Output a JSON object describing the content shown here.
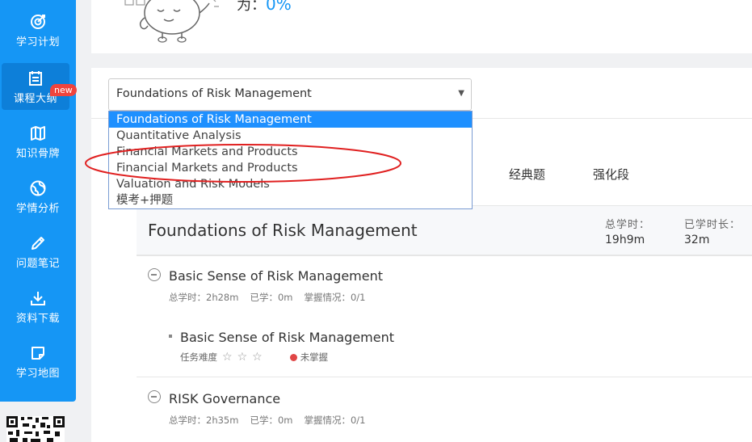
{
  "sidebar": {
    "items": [
      {
        "label": "学习计划",
        "icon": "target-icon"
      },
      {
        "label": "课程大纲",
        "icon": "calendar-list-icon"
      },
      {
        "label": "知识骨牌",
        "icon": "map-icon"
      },
      {
        "label": "学情分析",
        "icon": "globe-icon"
      },
      {
        "label": "问题笔记",
        "icon": "pencil-icon"
      },
      {
        "label": "资料下载",
        "icon": "download-icon"
      },
      {
        "label": "学习地图",
        "icon": "sticky-note-icon"
      }
    ],
    "badge": "new"
  },
  "progress": {
    "prefix": "为：",
    "value": "0%"
  },
  "course_select": {
    "selected": "Foundations of Risk Management",
    "options": [
      "Foundations of Risk Management",
      "Quantitative Analysis",
      "Financial Markets and Products",
      "Financial Markets and Products",
      "Valuation and Risk Models",
      "模考+押题"
    ]
  },
  "tabs": [
    "经典题",
    "强化段"
  ],
  "course": {
    "title": "Foundations of Risk Management",
    "total_label": "总学时：",
    "total_value": "19h9m",
    "studied_label": "已学时长：",
    "studied_value": "32m"
  },
  "chapters": [
    {
      "title": "Basic Sense of Risk Management",
      "total": "总学时：2h28m",
      "studied": "已学：0m",
      "mastery": "掌握情况：0/1"
    },
    {
      "title": "RISK Governance",
      "total": "总学时：2h35m",
      "studied": "已学：0m",
      "mastery": "掌握情况：0/1"
    }
  ],
  "task": {
    "title": "Basic Sense of Risk Management",
    "difficulty_label": "任务难度",
    "stars": [
      "☆",
      "☆",
      "☆"
    ],
    "status": "未掌握"
  },
  "colors": {
    "primary": "#1596f5",
    "status_red": "#e04646",
    "annotation_red": "#e02020"
  }
}
